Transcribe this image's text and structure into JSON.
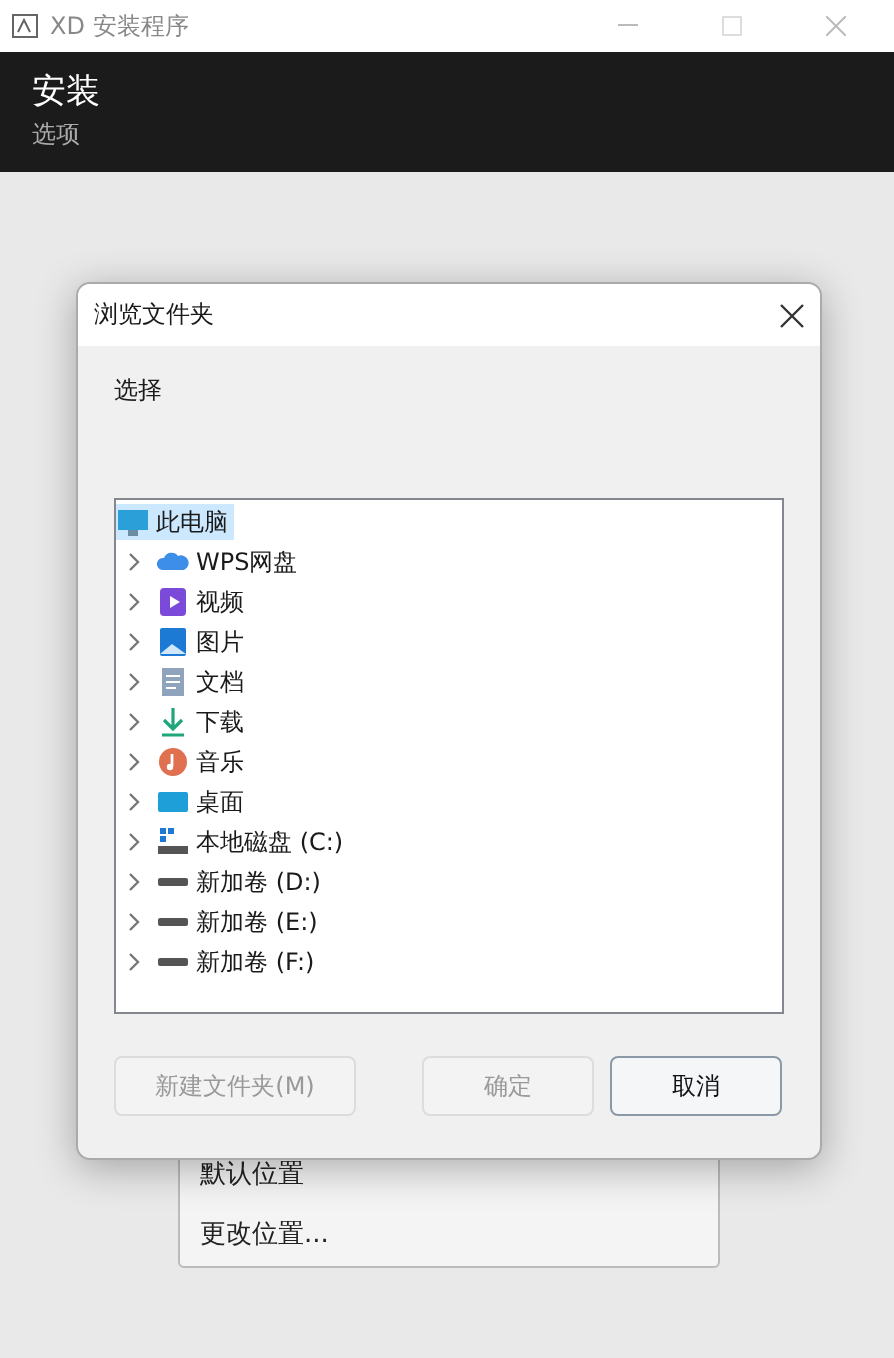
{
  "window": {
    "title": "XD 安装程序"
  },
  "header": {
    "title": "安装",
    "subtitle": "选项"
  },
  "menu": {
    "items": [
      {
        "label": "默认位置"
      },
      {
        "label": "更改位置..."
      }
    ]
  },
  "dialog": {
    "title": "浏览文件夹",
    "prompt": "选择",
    "tree": [
      {
        "label": "此电脑",
        "kind": "pc",
        "selected": true,
        "expanded": true,
        "children": [
          {
            "label": "WPS网盘",
            "kind": "cloud",
            "selected": false,
            "expanded": false
          },
          {
            "label": "视频",
            "kind": "video",
            "selected": false,
            "expanded": false
          },
          {
            "label": "图片",
            "kind": "pictures",
            "selected": false,
            "expanded": false
          },
          {
            "label": "文档",
            "kind": "documents",
            "selected": false,
            "expanded": false
          },
          {
            "label": "下载",
            "kind": "download",
            "selected": false,
            "expanded": false
          },
          {
            "label": "音乐",
            "kind": "music",
            "selected": false,
            "expanded": false
          },
          {
            "label": "桌面",
            "kind": "desktop",
            "selected": false,
            "expanded": false
          },
          {
            "label": "本地磁盘 (C:)",
            "kind": "system-drive",
            "selected": false,
            "expanded": false
          },
          {
            "label": "新加卷 (D:)",
            "kind": "drive",
            "selected": false,
            "expanded": false
          },
          {
            "label": "新加卷 (E:)",
            "kind": "drive",
            "selected": false,
            "expanded": false
          },
          {
            "label": "新加卷 (F:)",
            "kind": "drive",
            "selected": false,
            "expanded": false
          }
        ]
      }
    ],
    "buttons": [
      {
        "label": "新建文件夹(M)",
        "disabled": true,
        "default": false
      },
      {
        "label": "确定",
        "disabled": true,
        "default": false
      },
      {
        "label": "取消",
        "disabled": false,
        "default": true
      }
    ]
  }
}
